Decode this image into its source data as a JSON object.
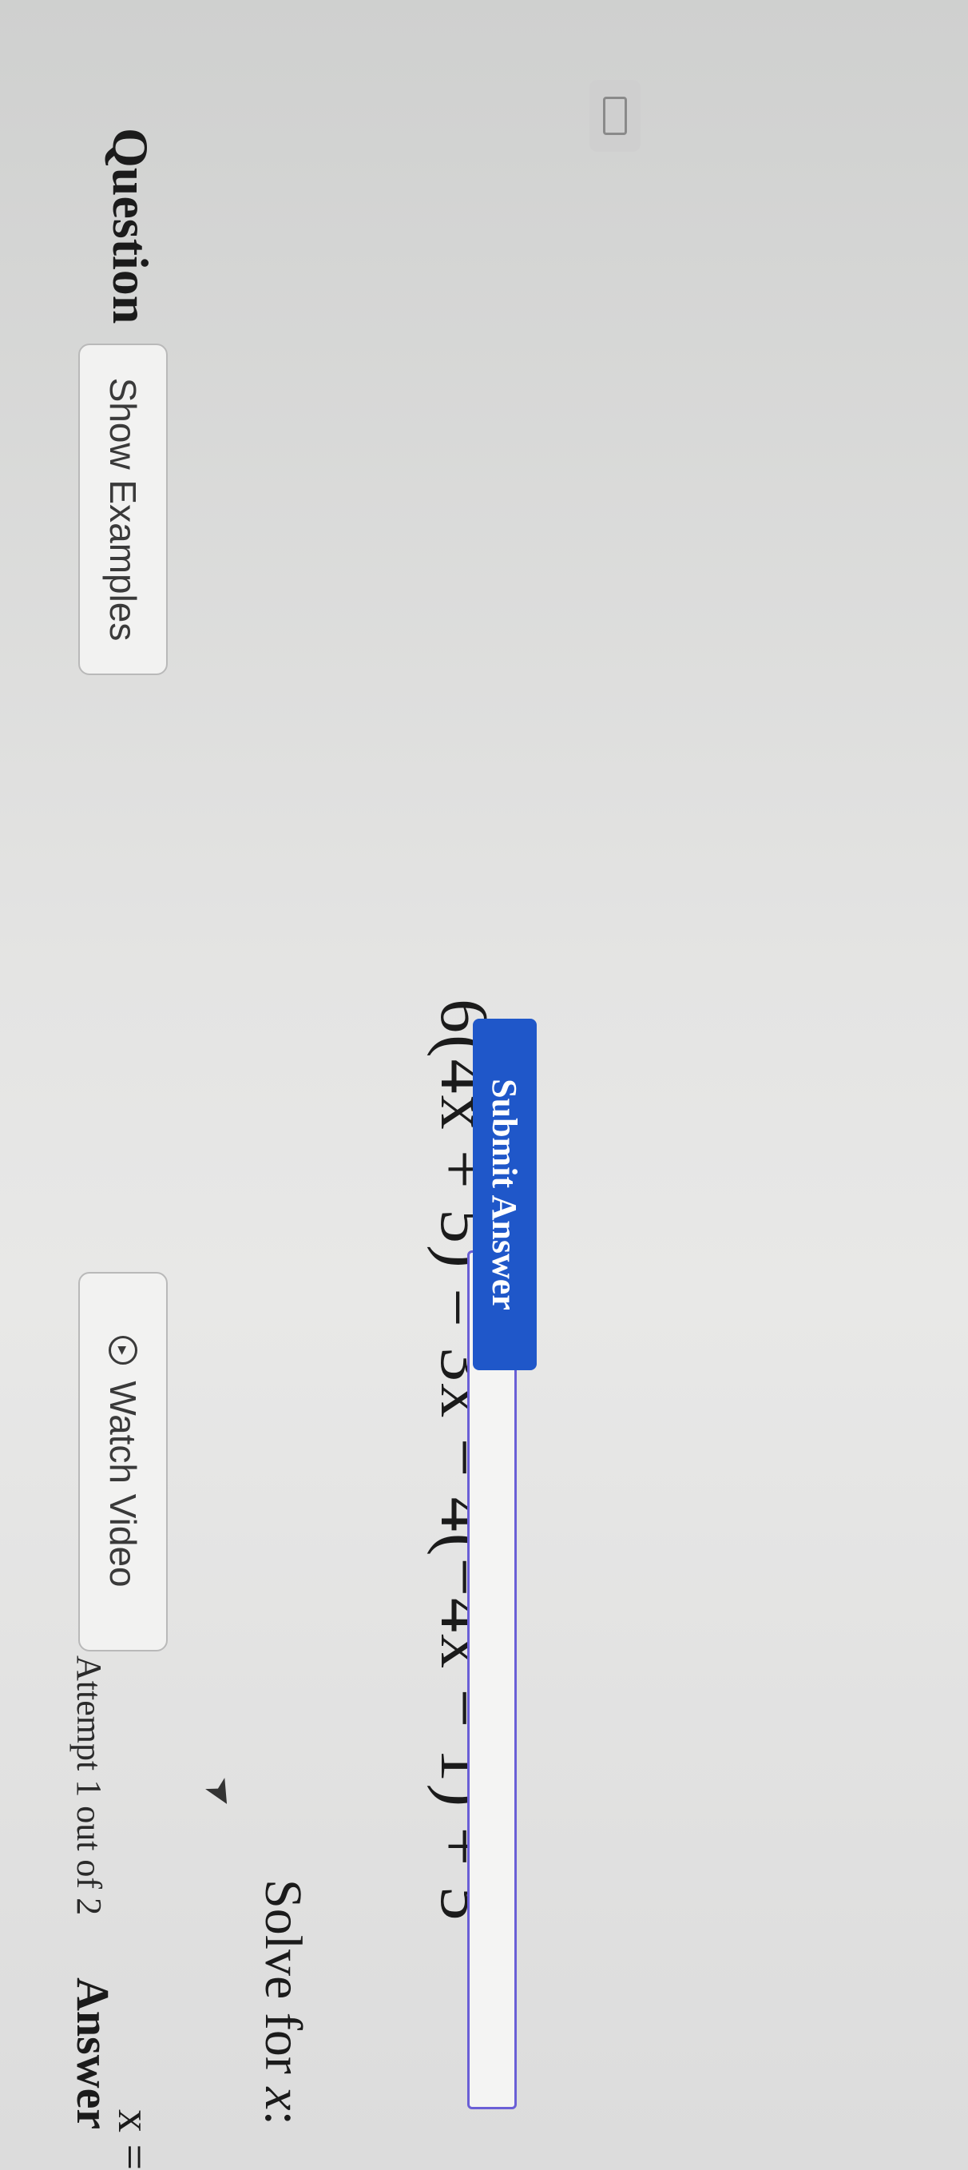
{
  "header": {
    "question_label": "Question",
    "watch_video_label": "Watch Video",
    "show_examples_label": "Show Examples",
    "watch_video_icon": "play-circle-icon",
    "keyboard_icon": "keyboard-icon"
  },
  "problem": {
    "instruction_prefix": "Solve for ",
    "variable": "x",
    "instruction_suffix": ":",
    "equation": {
      "lhs_coef": "6",
      "lhs_inner": "(4x + 5)",
      "equals": " = ",
      "rhs": "3x − 4(−4x − 1) + 5"
    }
  },
  "answer": {
    "label": "Answer",
    "attempt_text": "Attempt 1 out of 2",
    "variable_prefix": "x =",
    "input_value": "",
    "input_placeholder": "",
    "submit_label": "Submit Answer"
  },
  "colors": {
    "submit_bg": "#1f57c9",
    "input_border": "#6a5fd6"
  }
}
